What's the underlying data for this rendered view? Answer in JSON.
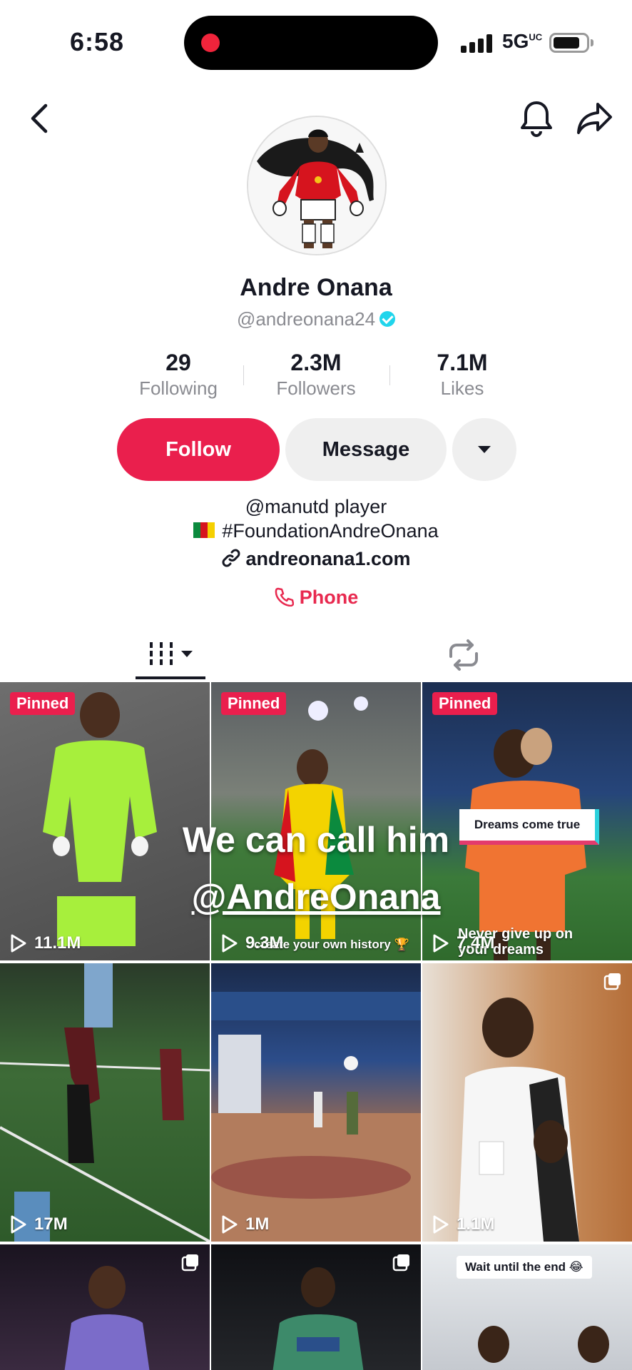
{
  "status_bar": {
    "time": "6:58",
    "network": "5G",
    "network_sup": "UC"
  },
  "profile": {
    "name": "Andre Onana",
    "handle": "@andreonana24",
    "stats": [
      {
        "value": "29",
        "label": "Following"
      },
      {
        "value": "2.3M",
        "label": "Followers"
      },
      {
        "value": "7.1M",
        "label": "Likes"
      }
    ],
    "buttons": {
      "follow": "Follow",
      "message": "Message"
    },
    "bio": {
      "line1": "@manutd player",
      "line2": "#FoundationAndreOnana",
      "link": "andreonana1.com",
      "phone": "Phone"
    }
  },
  "overlay": {
    "line1": "We can call him",
    "line2": "@AndreOnana"
  },
  "videos": [
    {
      "views": "11.1M",
      "badge": "Pinned"
    },
    {
      "views": "9.3M",
      "badge": "Pinned",
      "caption": "create your own history 🏆"
    },
    {
      "views": "7.4M",
      "badge": "Pinned",
      "text_box": "Dreams come true",
      "caption": "Never give up on your dreams"
    },
    {
      "views": "17M"
    },
    {
      "views": "1M"
    },
    {
      "views": "1.1M"
    },
    {
      "views": ""
    },
    {
      "views": ""
    },
    {
      "views": "",
      "text_box": "Wait until the end 😂"
    }
  ],
  "colors": {
    "accent": "#ea1f4d",
    "verified": "#20d5ec",
    "muted": "#8a8b91"
  },
  "icons": [
    "back-arrow-icon",
    "bell-icon",
    "share-icon",
    "verified-icon",
    "link-icon",
    "phone-icon",
    "videos-grid-icon",
    "repost-icon",
    "play-icon",
    "multi-photo-icon"
  ]
}
